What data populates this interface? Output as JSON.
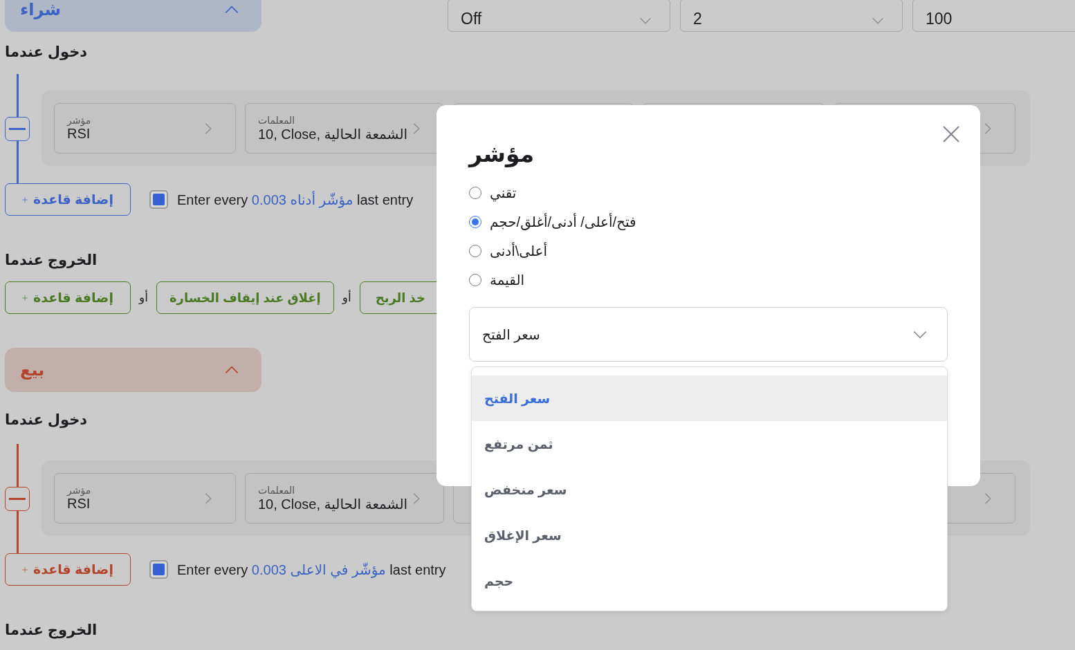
{
  "top_fields": [
    {
      "kind": "input",
      "value": "100"
    },
    {
      "kind": "select",
      "value": "2"
    },
    {
      "kind": "select",
      "value": "Off"
    }
  ],
  "sections": [
    {
      "kind": "buy",
      "title": "شراء",
      "expanded": true,
      "entry": {
        "heading": "دخول عندما",
        "conditions": [
          {
            "label": "المعلمات",
            "value": "10, Close, الشمعة الحالية"
          },
          {
            "label": "مؤشر",
            "value": "RSI"
          }
        ],
        "add_rule": "إضافة قاعدة",
        "repeat": {
          "checked": true,
          "prefix": "Enter every ",
          "highlight": "0.003 مؤشّر أدناه",
          "suffix": " last entry"
        }
      },
      "exit": {
        "heading": "الخروج عندما",
        "actions": [
          {
            "kind": "action",
            "label": "خذ الربح"
          },
          {
            "kind": "or",
            "label": "أو"
          },
          {
            "kind": "action",
            "label": "إغلاق عند إيقاف الخسارة"
          },
          {
            "kind": "or",
            "label": "أو"
          },
          {
            "kind": "add",
            "label": "إضافة قاعدة"
          }
        ]
      }
    },
    {
      "kind": "sell",
      "title": "بيع",
      "expanded": true,
      "entry": {
        "heading": "دخول عندما",
        "conditions": [
          {
            "label": "المعلمات",
            "value": "10, Close, الشمعة الحالية"
          },
          {
            "label": "مؤشر",
            "value": "RSI"
          }
        ],
        "add_rule": "إضافة قاعدة",
        "repeat": {
          "checked": true,
          "prefix": "Enter every ",
          "highlight": "0.003 مؤشّر في الاعلى",
          "suffix": " last entry"
        }
      },
      "exit": {
        "heading": "الخروج عندما"
      }
    }
  ],
  "modal": {
    "title": "مؤشر",
    "options": [
      {
        "label": "تقني",
        "selected": false
      },
      {
        "label": "فتح/أعلى/ أدنى/أغلق/حجم",
        "selected": true
      },
      {
        "label": "أعلى\\أدنى",
        "selected": false
      },
      {
        "label": "القيمة",
        "selected": false
      }
    ],
    "select": {
      "value": "سعر الفتح",
      "expanded": true,
      "options": [
        {
          "label": "سعر الفتح",
          "selected": true
        },
        {
          "label": "ثمن مرتفع",
          "selected": false
        },
        {
          "label": "سعر منخفض",
          "selected": false
        },
        {
          "label": "سعر الإغلاق",
          "selected": false
        },
        {
          "label": "حجم",
          "selected": false
        }
      ]
    }
  }
}
